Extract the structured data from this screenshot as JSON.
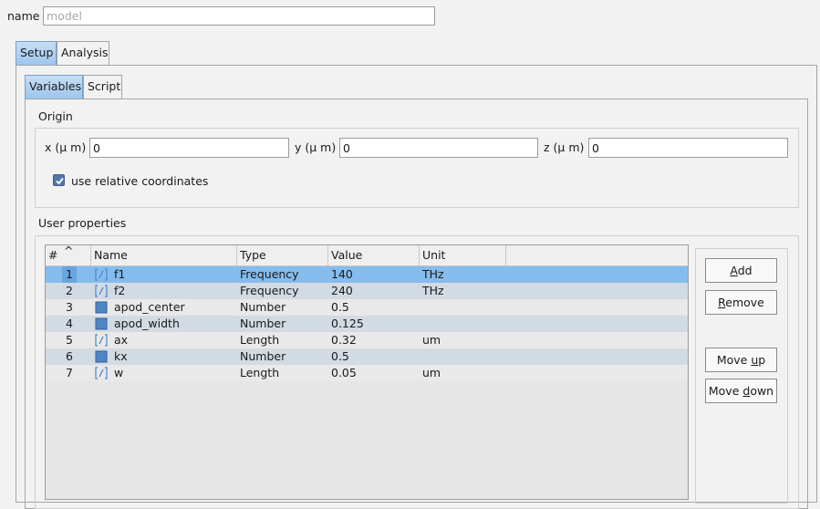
{
  "name_field": {
    "label": "name",
    "placeholder": "model",
    "value": ""
  },
  "outer_tabs": [
    {
      "label": "Setup",
      "active": true
    },
    {
      "label": "Analysis",
      "active": false
    }
  ],
  "inner_tabs": [
    {
      "label": "Variables",
      "active": true
    },
    {
      "label": "Script",
      "active": false
    }
  ],
  "origin": {
    "title": "Origin",
    "x": {
      "label": "x (μ m)",
      "value": "0"
    },
    "y": {
      "label": "y (μ m)",
      "value": "0"
    },
    "z": {
      "label": "z (μ m)",
      "value": "0"
    },
    "relative_coordinates": {
      "label": "use relative coordinates",
      "checked": true
    }
  },
  "user_properties": {
    "title": "User properties",
    "columns": [
      "#",
      "Name",
      "Type",
      "Value",
      "Unit"
    ],
    "sort_indicator": "^",
    "rows": [
      {
        "num": "1",
        "icon": "script-icon",
        "name": "f1",
        "type": "Frequency",
        "value": "140",
        "unit": "THz",
        "selected": true
      },
      {
        "num": "2",
        "icon": "script-icon",
        "name": "f2",
        "type": "Frequency",
        "value": "240",
        "unit": "THz",
        "selected": false
      },
      {
        "num": "3",
        "icon": "square-icon",
        "name": "apod_center",
        "type": "Number",
        "value": "0.5",
        "unit": "",
        "selected": false
      },
      {
        "num": "4",
        "icon": "square-icon",
        "name": "apod_width",
        "type": "Number",
        "value": "0.125",
        "unit": "",
        "selected": false
      },
      {
        "num": "5",
        "icon": "script-icon",
        "name": "ax",
        "type": "Length",
        "value": "0.32",
        "unit": "um",
        "selected": false
      },
      {
        "num": "6",
        "icon": "square-icon",
        "name": "kx",
        "type": "Number",
        "value": "0.5",
        "unit": "",
        "selected": false
      },
      {
        "num": "7",
        "icon": "script-icon",
        "name": "w",
        "type": "Length",
        "value": "0.05",
        "unit": "um",
        "selected": false
      }
    ],
    "buttons": {
      "add": "Add",
      "remove": "Remove",
      "move_up": "Move up",
      "move_down": "Move down"
    }
  },
  "colors": {
    "selection": "#86bcec",
    "alt_row": "#d2dbe3",
    "active_tab": "#9fc6ec",
    "checkbox": "#5478a6"
  }
}
